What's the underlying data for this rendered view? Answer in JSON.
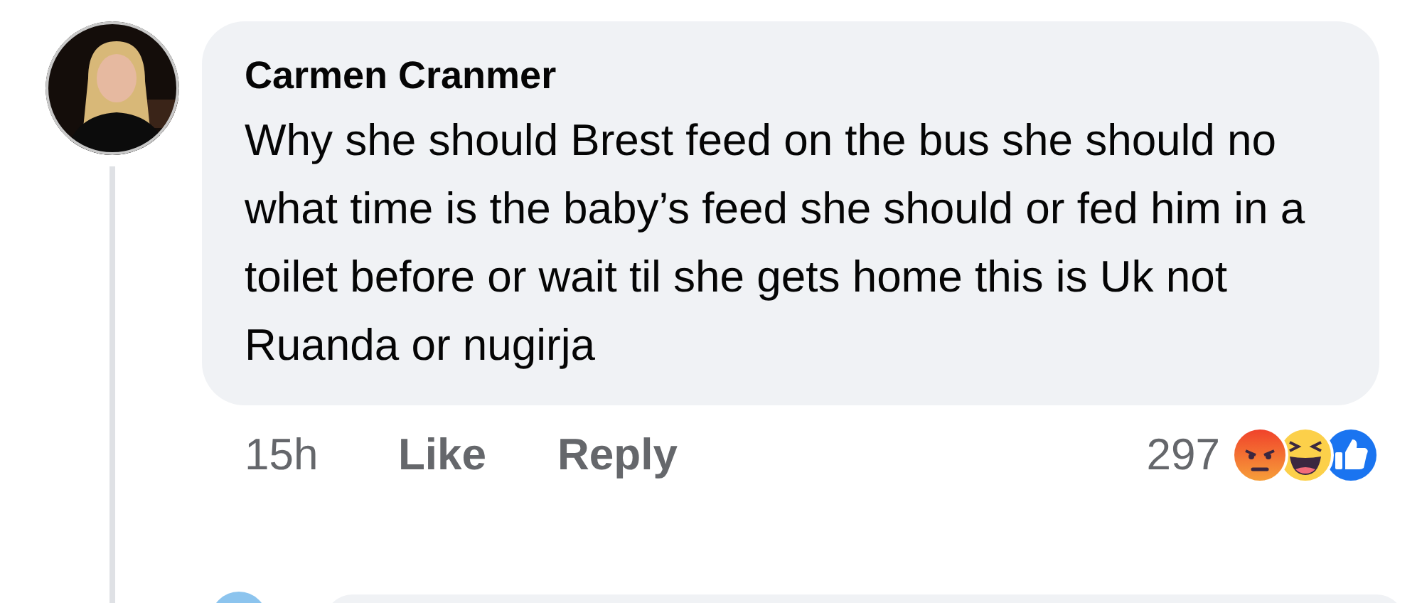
{
  "comment": {
    "author": "Carmen Cranmer",
    "text": "Why she should Brest feed on the bus she should no what time is the baby’s feed she should or fed him in a toilet before or wait til she gets home this is Uk not Ruanda or nugirja",
    "time": "15h",
    "actions": [
      "Like",
      "Reply"
    ],
    "reaction_count": "297"
  }
}
